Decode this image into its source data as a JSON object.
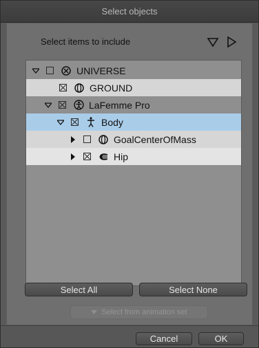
{
  "window": {
    "title": "Select objects"
  },
  "header": {
    "label": "Select items to include",
    "expand_all_icon": "triangle-down-icon",
    "collapse_all_icon": "triangle-right-icon"
  },
  "tree": {
    "items": [
      {
        "label": "UNIVERSE",
        "expander": "expanded",
        "checked": false,
        "icon": "universe-icon"
      },
      {
        "label": "GROUND",
        "expander": "none",
        "checked": true,
        "icon": "ground-icon"
      },
      {
        "label": "LaFemme Pro",
        "expander": "expanded",
        "checked": true,
        "icon": "figure-icon"
      },
      {
        "label": "Body",
        "expander": "expanded",
        "checked": true,
        "icon": "body-icon",
        "selected": true
      },
      {
        "label": "GoalCenterOfMass",
        "expander": "collapsed",
        "checked": false,
        "icon": "goal-icon"
      },
      {
        "label": "Hip",
        "expander": "collapsed",
        "checked": true,
        "icon": "hip-icon"
      }
    ]
  },
  "buttons": {
    "select_all": "Select All",
    "select_none": "Select None",
    "select_from_animation_set": "Select from animation set",
    "cancel": "Cancel",
    "ok": "OK"
  },
  "colors": {
    "selected_row": "#a9cde9",
    "panel": "#6f6f6f",
    "tree_bg": "#8f8f8f"
  }
}
